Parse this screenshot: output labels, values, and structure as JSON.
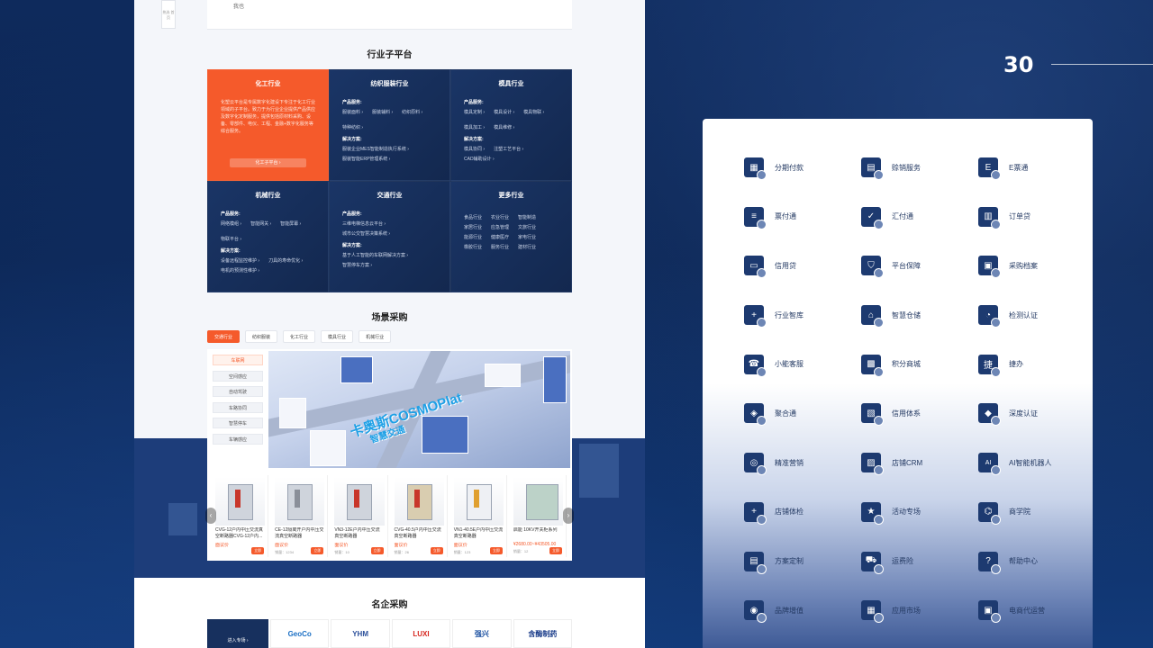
{
  "page_number": "30",
  "mock_page": {
    "top": {
      "side_float": "热选 首页",
      "small": "我也"
    },
    "industry_section_title": "行业子平台",
    "industries": [
      {
        "name": "化工行业",
        "active": true,
        "desc": "化塑云平台是专属数字化建设下专注于化工行业领域的子平台。致力于为行业企业提供产品供应及数字化定制服务，提供包括原材料采购、设备、零部件、电仪、工程、金融+数字化服务等综合服务。",
        "button": "化工子平台 ›"
      },
      {
        "name": "纺织服装行业",
        "prod_label": "产品服务:",
        "prod": [
          "服装面料 ›",
          "服装辅料 ›",
          "纺织原料 ›",
          "特种纺织 ›"
        ],
        "sol_label": "解决方案:",
        "sol": [
          "服装企业MES智能制造执行系统 ›",
          "服装智能ERP管理系统 ›"
        ]
      },
      {
        "name": "模具行业",
        "prod_label": "产品服务:",
        "prod": [
          "模具定制 ›",
          "模具设计 ›",
          "模具物联 ›",
          "模具加工 ›",
          "模具维修 ›"
        ],
        "sol_label": "解决方案:",
        "sol": [
          "模具协同 ›",
          "注塑工艺平台 ›",
          "CAD辅助设计 ›"
        ]
      },
      {
        "name": "机械行业",
        "prod_label": "产品服务:",
        "prod": [
          "网络模组 ›",
          "智能网关 ›",
          "智能屏幕 ›",
          "物联平台 ›"
        ],
        "sol_label": "解决方案:",
        "sol": [
          "设备远程监控维护 ›",
          "刀具的寿命优化 ›",
          "电机的预测性维护 ›"
        ]
      },
      {
        "name": "交通行业",
        "prod_label": "产品服务:",
        "prod": [
          "三维电梯信息云平台 ›",
          "城市公交智慧决策系统 ›"
        ],
        "sol_label": "解决方案:",
        "sol": [
          "基于人工智能的车联网解决方案 ›",
          "智慧停车方案 ›"
        ]
      },
      {
        "name": "更多行业",
        "more": [
          "食品行业",
          "农业行业",
          "智能制造",
          "家居行业",
          "应急管理",
          "文旅行业",
          "能源行业",
          "健康医疗",
          "家电行业",
          "橡胶行业",
          "服务行业",
          "建材行业"
        ]
      }
    ],
    "scene_section_title": "场景采购",
    "scene_tabs": [
      "交通行业",
      "纺织服装",
      "化工行业",
      "模具行业",
      "机械行业"
    ],
    "scene_menu": [
      "车联网",
      "空间感应",
      "自动驾驶",
      "车路协同",
      "智慧停车",
      "车辆感应"
    ],
    "scene_brand": "卡奥斯COSMOPlat",
    "scene_brand_sub": "智慧交通",
    "products": [
      {
        "title": "CVG-12户内中压交流真空断路器CVG-12户内...",
        "price": "面议价",
        "sub": "",
        "buy": "立即"
      },
      {
        "title": "CE-12隔离开户内中压交流真空断路器",
        "price": "面议价",
        "sub": "销量：1234",
        "buy": "立即"
      },
      {
        "title": "VN3-12E户内中压交流真空断路器",
        "price": "面议价",
        "sub": "销量：10",
        "buy": "立即"
      },
      {
        "title": "CVG-40.5户内中压交流真空断路器",
        "price": "面议价",
        "sub": "销量：26",
        "buy": "立即"
      },
      {
        "title": "VN1-40.5E户内中压交流真空断路器",
        "price": "面议价",
        "sub": "销量：123",
        "buy": "立即"
      },
      {
        "title": "启能 10KV开关柜系列",
        "price": "¥2680.00~¥43505.00",
        "sub": "销量：12",
        "buy": "立即"
      }
    ],
    "brand_section_title": "名企采购",
    "brand_enter": "进入专场 ›",
    "brand_logos": [
      "GeoCo",
      "YHM",
      "LUXI",
      "强兴",
      "含酶制药"
    ]
  },
  "icon_panel": {
    "items": [
      {
        "label": "分期付款",
        "icon": "calendar-pay-icon",
        "glyph": "▦"
      },
      {
        "label": "赊销服务",
        "icon": "credit-sale-icon",
        "glyph": "▤"
      },
      {
        "label": "E票通",
        "icon": "e-ticket-icon",
        "glyph": "E"
      },
      {
        "label": "票付通",
        "icon": "ticket-pay-icon",
        "glyph": "≡"
      },
      {
        "label": "汇付通",
        "icon": "remit-icon",
        "glyph": "✓"
      },
      {
        "label": "订单贷",
        "icon": "order-loan-icon",
        "glyph": "▥"
      },
      {
        "label": "信用贷",
        "icon": "credit-loan-icon",
        "glyph": "▭"
      },
      {
        "label": "平台保障",
        "icon": "platform-guarantee-icon",
        "glyph": "⛉"
      },
      {
        "label": "采购档案",
        "icon": "purchase-archive-icon",
        "glyph": "▣"
      },
      {
        "label": "行业智库",
        "icon": "industry-think-tank-icon",
        "glyph": "+"
      },
      {
        "label": "智慧仓储",
        "icon": "smart-warehouse-icon",
        "glyph": "⌂"
      },
      {
        "label": "检测认证",
        "icon": "inspection-cert-icon",
        "glyph": "◔"
      },
      {
        "label": "小能客服",
        "icon": "customer-service-icon",
        "glyph": "☎"
      },
      {
        "label": "积分商城",
        "icon": "points-mall-icon",
        "glyph": "▩"
      },
      {
        "label": "捷办",
        "icon": "quick-handle-icon",
        "glyph": "捷"
      },
      {
        "label": "聚合通",
        "icon": "aggregate-icon",
        "glyph": "◈"
      },
      {
        "label": "信用体系",
        "icon": "credit-system-icon",
        "glyph": "▧"
      },
      {
        "label": "深度认证",
        "icon": "deep-cert-icon",
        "glyph": "◆"
      },
      {
        "label": "精准营销",
        "icon": "precision-marketing-icon",
        "glyph": "◎"
      },
      {
        "label": "店铺CRM",
        "icon": "store-crm-icon",
        "glyph": "▨"
      },
      {
        "label": "AI智能机器人",
        "icon": "ai-robot-icon",
        "glyph": "AI"
      },
      {
        "label": "店铺体检",
        "icon": "store-checkup-icon",
        "glyph": "+"
      },
      {
        "label": "活动专场",
        "icon": "event-flag-icon",
        "glyph": "★"
      },
      {
        "label": "商学院",
        "icon": "business-school-icon",
        "glyph": "⌬"
      },
      {
        "label": "方案定制",
        "icon": "solution-custom-icon",
        "glyph": "▤"
      },
      {
        "label": "运费险",
        "icon": "freight-insurance-icon",
        "glyph": "⛟"
      },
      {
        "label": "帮助中心",
        "icon": "help-center-icon",
        "glyph": "?"
      },
      {
        "label": "品牌增值",
        "icon": "brand-value-icon",
        "glyph": "◉"
      },
      {
        "label": "应用市场",
        "icon": "app-market-icon",
        "glyph": "▦"
      },
      {
        "label": "电商代运营",
        "icon": "ecommerce-ops-icon",
        "glyph": "▣"
      }
    ]
  }
}
